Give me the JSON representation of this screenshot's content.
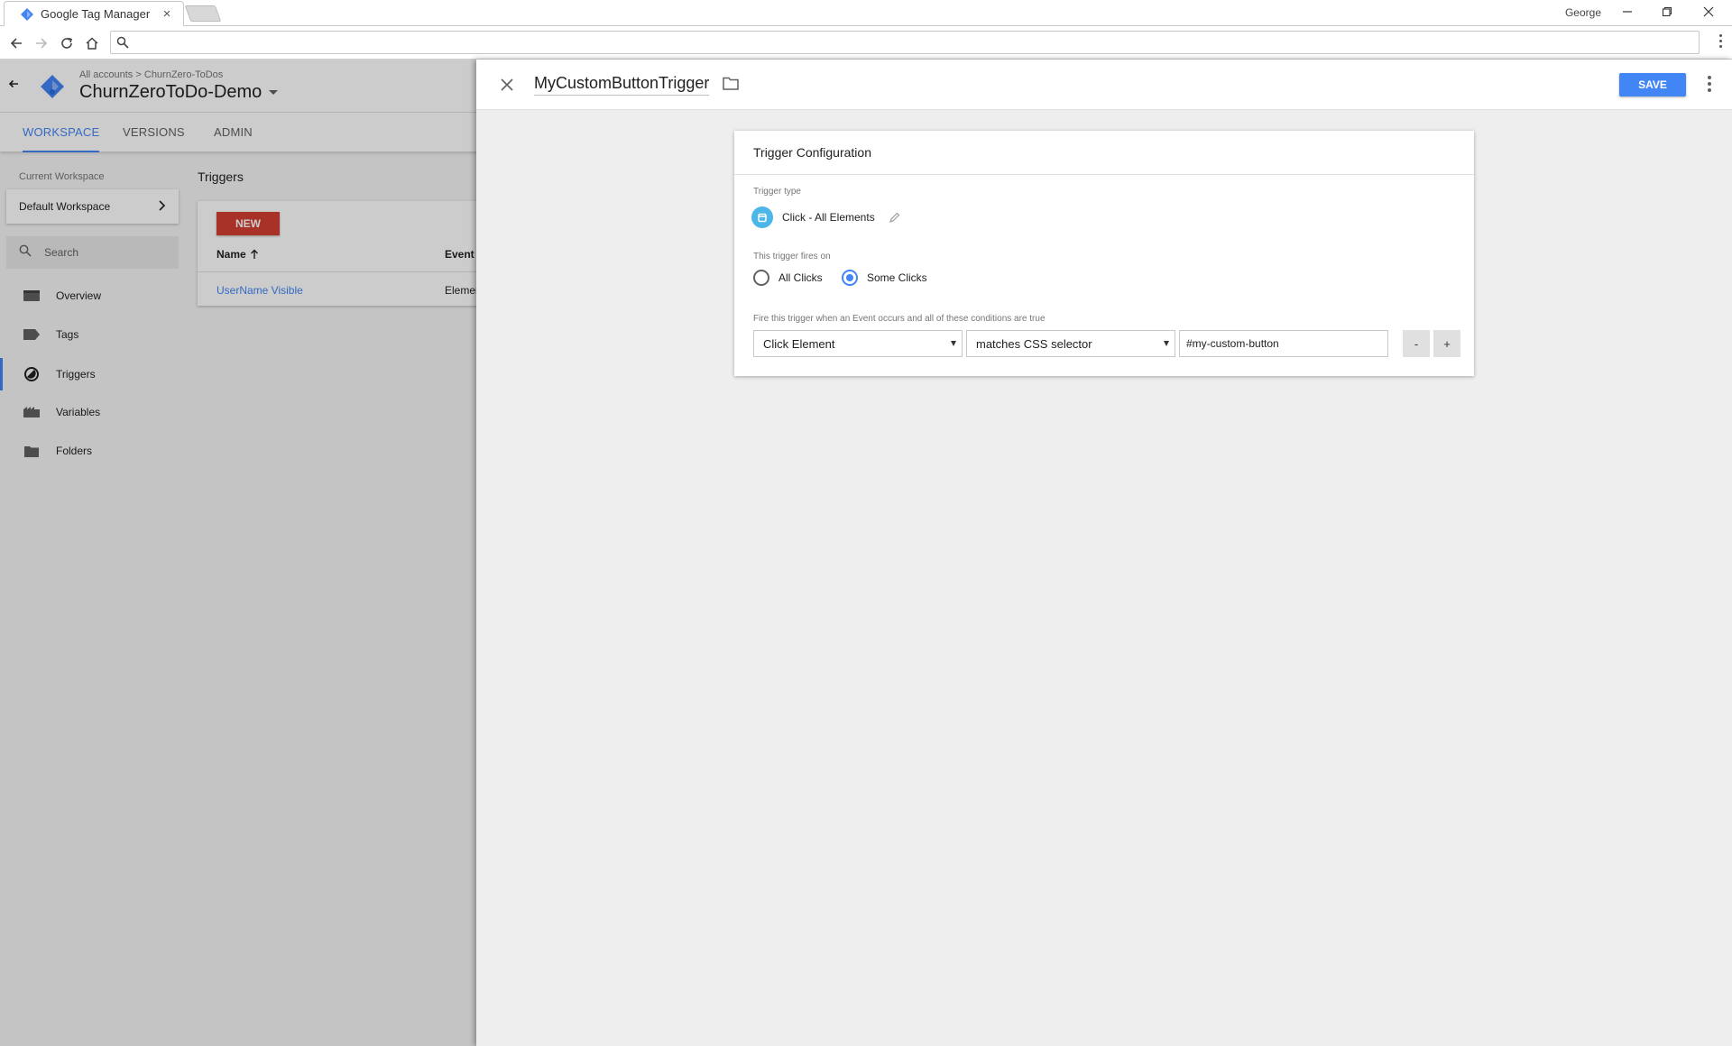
{
  "browser": {
    "tab_title": "Google Tag Manager",
    "tab_close": "×",
    "profile_name": "George",
    "address_value": "",
    "address_placeholder": ""
  },
  "app": {
    "breadcrumb_accounts": "All accounts",
    "breadcrumb_sep": ">",
    "breadcrumb_account": "ChurnZero-ToDos",
    "container_name": "ChurnZeroToDo-Demo",
    "nav_tabs": [
      {
        "label": "WORKSPACE",
        "active": true
      },
      {
        "label": "VERSIONS",
        "active": false
      },
      {
        "label": "ADMIN",
        "active": false
      }
    ],
    "workspace_label": "Current Workspace",
    "workspace_name": "Default Workspace",
    "search_placeholder": "Search",
    "sidebar_items": [
      {
        "label": "Overview",
        "icon": "overview-icon"
      },
      {
        "label": "Tags",
        "icon": "tag-icon"
      },
      {
        "label": "Triggers",
        "icon": "trigger-icon",
        "active": true
      },
      {
        "label": "Variables",
        "icon": "variables-icon"
      },
      {
        "label": "Folders",
        "icon": "folder-icon"
      }
    ],
    "section_title": "Triggers",
    "new_button": "NEW",
    "columns": [
      "Name",
      "Event Type"
    ],
    "rows": [
      {
        "name": "UserName Visible",
        "event_type": "Element Visibility"
      }
    ]
  },
  "panel": {
    "title": "MyCustomButtonTrigger",
    "save_label": "SAVE",
    "card_title": "Trigger Configuration",
    "trigger_type_label": "Trigger type",
    "trigger_type": "Click - All Elements",
    "fires_on_label": "This trigger fires on",
    "fires_on_options": [
      {
        "label": "All Clicks",
        "selected": false
      },
      {
        "label": "Some Clicks",
        "selected": true
      }
    ],
    "condition_label": "Fire this trigger when an Event occurs and all of these conditions are true",
    "condition": {
      "variable": "Click Element",
      "operator": "matches CSS selector",
      "value": "#my-custom-button",
      "remove_label": "-",
      "add_label": "+"
    }
  },
  "colors": {
    "accent": "#4285f4",
    "new_button": "#d23f31",
    "trigger_icon": "#4db6e9"
  }
}
